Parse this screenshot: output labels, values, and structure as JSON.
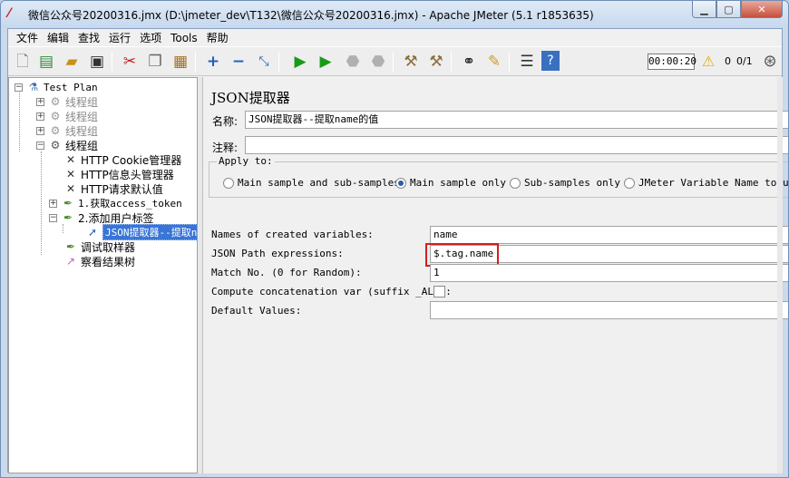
{
  "window": {
    "title": "微信公众号20200316.jmx (D:\\jmeter_dev\\T132\\微信公众号20200316.jmx) - Apache JMeter (5.1 r1853635)",
    "app_icon": "jmeter-feather-icon"
  },
  "menubar": {
    "items": [
      "文件",
      "编辑",
      "查找",
      "运行",
      "选项",
      "Tools",
      "帮助"
    ]
  },
  "toolbar": {
    "icons": [
      "new-icon",
      "templates-icon",
      "open-icon",
      "save-icon",
      "cut-icon",
      "copy-icon",
      "paste-icon",
      "expand-icon",
      "collapse-icon",
      "toggle-icon",
      "start-icon",
      "start-no-pause-icon",
      "stop-icon",
      "shutdown-icon",
      "clear-icon",
      "clear-all-icon",
      "search-icon",
      "reset-search-icon",
      "function-helper-icon",
      "help-icon"
    ],
    "timer": "00:00:20",
    "warnings": "0",
    "threads": "0/1"
  },
  "tree": {
    "root": "Test Plan",
    "thread_groups": [
      "线程组",
      "线程组",
      "线程组",
      "线程组"
    ],
    "children": [
      "HTTP Cookie管理器",
      "HTTP信息头管理器",
      "HTTP请求默认值",
      "1.获取access_token",
      "2.添加用户标签",
      "JSON提取器--提取n",
      "调试取样器",
      "察看结果树"
    ]
  },
  "panel": {
    "title": "JSON提取器",
    "name_label": "名称:",
    "name_value": "JSON提取器--提取name的值",
    "comment_label": "注释:",
    "comment_value": "",
    "apply_to": {
      "title": "Apply to:",
      "options": [
        "Main sample and sub-samples",
        "Main sample only",
        "Sub-samples only",
        "JMeter Variable Name to use"
      ],
      "selected": "Main sample only"
    },
    "fields": {
      "names_label": "Names of created variables:",
      "names_value": "name",
      "path_label": "JSON Path expressions:",
      "path_value": "$.tag.name",
      "match_label": "Match No. (0 for Random):",
      "match_value": "1",
      "concat_label": "Compute concatenation var (suffix _ALL):",
      "default_label": "Default Values:",
      "default_value": ""
    }
  },
  "colors": {
    "selection": "#3875d7",
    "highlight_box": "#d02020",
    "start_green": "#1a9a1a"
  }
}
